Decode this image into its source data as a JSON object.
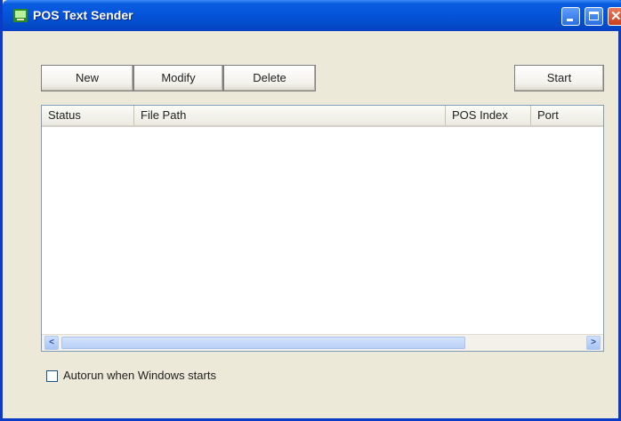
{
  "window": {
    "title": "POS Text Sender",
    "icon": "app-icon",
    "controls": [
      "minimize-icon",
      "maximize-icon",
      "close-icon"
    ]
  },
  "toolbar": {
    "new_label": "New",
    "modify_label": "Modify",
    "delete_label": "Delete",
    "start_label": "Start"
  },
  "list": {
    "columns": [
      "Status",
      "File Path",
      "POS Index",
      "Port"
    ],
    "rows": []
  },
  "options": {
    "autorun_label": "Autorun when Windows starts",
    "autorun_checked": false
  },
  "colors": {
    "titlebar": "#0553d8",
    "window_bg": "#ece9d8",
    "close_button": "#c6401d"
  }
}
